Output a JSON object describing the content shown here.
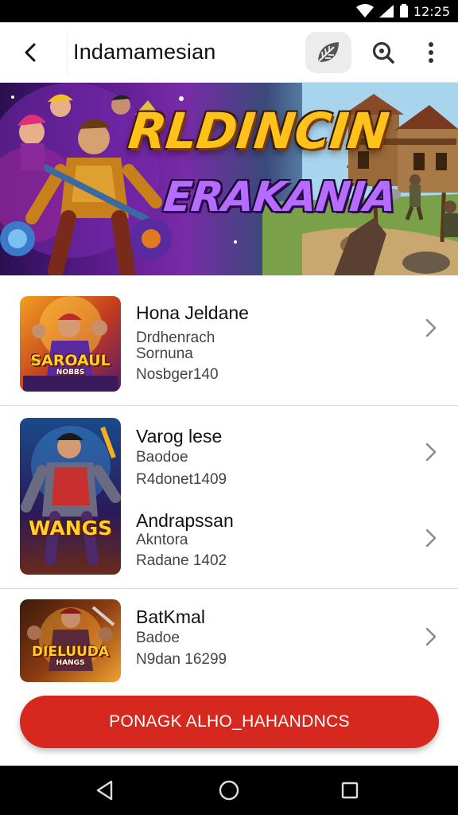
{
  "status_bar": {
    "time": "12:25"
  },
  "app_bar": {
    "title": "Indamamesian",
    "back_icon": "arrow-left-icon",
    "leaf_icon": "leaf-icon",
    "search_icon": "search-icon",
    "more_icon": "more-vertical-icon"
  },
  "banner": {
    "title": "RLDINCIN",
    "subtitle": "ERAKANIA",
    "page_count": 4,
    "active_page": 1
  },
  "games": [
    {
      "title": "Hona Jeldane",
      "line1": "Drdhenrach",
      "line2": "Sornuna",
      "line3": "Nosbger140",
      "thumb_text": "SAROAUL",
      "thumb_sub": "NOBBS"
    },
    {
      "title": "Varog lese",
      "line1": "Baodoe",
      "line2": "R4donet1409",
      "thumb_text": "WANGS"
    },
    {
      "title": "Andrapssan",
      "line1": "Akntora",
      "line2": "Radane 1402"
    },
    {
      "title": "BatKmal",
      "line1": "Badoe",
      "line2": "N9dan 16299",
      "thumb_text": "DIELUUDA",
      "thumb_sub": "HANGS"
    }
  ],
  "cta": {
    "label": "PONAGK ALHO_HAHANDNCS"
  },
  "colors": {
    "accent": "#d6281e",
    "title_gold": "#ffc21a",
    "subtitle_purple": "#b56cff"
  }
}
